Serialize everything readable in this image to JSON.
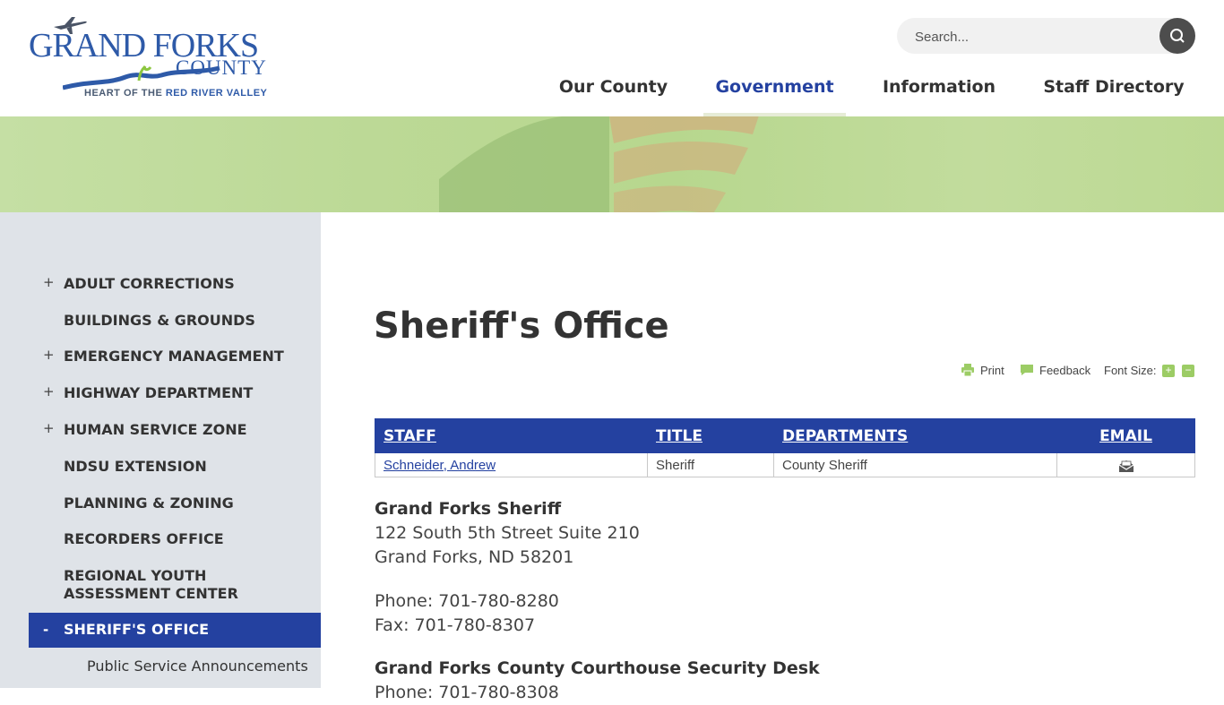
{
  "header": {
    "logo": {
      "line1": "GRAND FORKS",
      "line2": "COUNTY",
      "tagline_a": "HEART OF THE ",
      "tagline_b": "RED RIVER VALLEY"
    },
    "search": {
      "placeholder": "Search..."
    },
    "nav": [
      {
        "label": "Our County",
        "active": false
      },
      {
        "label": "Government",
        "active": true
      },
      {
        "label": "Information",
        "active": false
      },
      {
        "label": "Staff Directory",
        "active": false
      }
    ]
  },
  "sidebar": {
    "items": [
      {
        "label": "ADULT CORRECTIONS",
        "toggle": "+"
      },
      {
        "label": "BUILDINGS & GROUNDS",
        "toggle": ""
      },
      {
        "label": "EMERGENCY MANAGEMENT",
        "toggle": "+"
      },
      {
        "label": "HIGHWAY DEPARTMENT",
        "toggle": "+"
      },
      {
        "label": "HUMAN SERVICE ZONE",
        "toggle": "+"
      },
      {
        "label": "NDSU EXTENSION",
        "toggle": ""
      },
      {
        "label": "PLANNING & ZONING",
        "toggle": ""
      },
      {
        "label": "RECORDERS OFFICE",
        "toggle": ""
      },
      {
        "label": "REGIONAL YOUTH ASSESSMENT CENTER",
        "toggle": ""
      },
      {
        "label": "SHERIFF'S OFFICE",
        "toggle": "-"
      }
    ],
    "sub_items": [
      "Public Service Announcements"
    ]
  },
  "main": {
    "title": "Sheriff's Office",
    "tools": {
      "print": "Print",
      "feedback": "Feedback",
      "font_size": "Font Size:",
      "increase": "+",
      "decrease": "−"
    },
    "staff_table": {
      "headers": [
        "STAFF",
        "TITLE",
        "DEPARTMENTS",
        "EMAIL"
      ],
      "rows": [
        {
          "staff": "Schneider, Andrew",
          "title": "Sheriff",
          "department": "County Sheriff",
          "email_icon": "envelope-icon"
        }
      ]
    },
    "contact": {
      "heading": "Grand Forks Sheriff",
      "address1": "122 South 5th Street Suite 210",
      "address2": "Grand Forks, ND 58201",
      "phone": "Phone: 701-780-8280",
      "fax": "Fax: 701-780-8307",
      "security_heading": "Grand Forks County Courthouse Security Desk",
      "security_phone": "Phone: 701-780-8308"
    }
  },
  "colors": {
    "primary": "#2441a0",
    "sidebar_bg": "#dfe3e8",
    "banner": "#c1dc9c",
    "accent_green": "#9ccc65"
  }
}
